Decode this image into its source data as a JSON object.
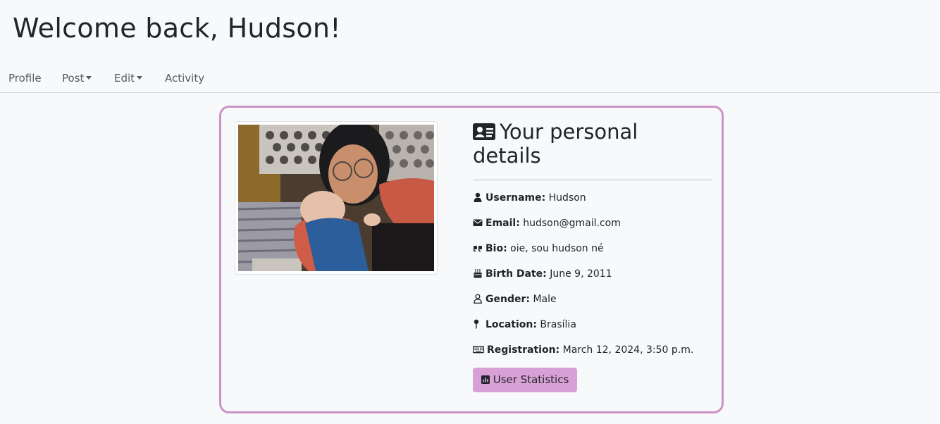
{
  "header": {
    "welcome": "Welcome back, Hudson!"
  },
  "nav": {
    "profile": "Profile",
    "post": "Post",
    "edit": "Edit",
    "activity": "Activity"
  },
  "profile": {
    "heading": "Your personal details",
    "fields": [
      {
        "icon": "user-icon",
        "label": "Username:",
        "value": "Hudson"
      },
      {
        "icon": "envelope-icon",
        "label": "Email:",
        "value": "hudson@gmail.com"
      },
      {
        "icon": "quote-icon",
        "label": "Bio:",
        "value": "oie, sou hudson né"
      },
      {
        "icon": "birthday-cake-icon",
        "label": "Birth Date:",
        "value": "June 9, 2011"
      },
      {
        "icon": "person-outline-icon",
        "label": "Gender:",
        "value": "Male"
      },
      {
        "icon": "map-pin-icon",
        "label": "Location:",
        "value": "Brasília"
      },
      {
        "icon": "keyboard-icon",
        "label": "Registration:",
        "value": "March 12, 2024, 3:50 p.m."
      }
    ],
    "stats_button": "User Statistics"
  },
  "colors": {
    "accent_border": "#cc93c6",
    "button_bg": "#d8a1d6",
    "page_bg": "#f8f9fb"
  }
}
